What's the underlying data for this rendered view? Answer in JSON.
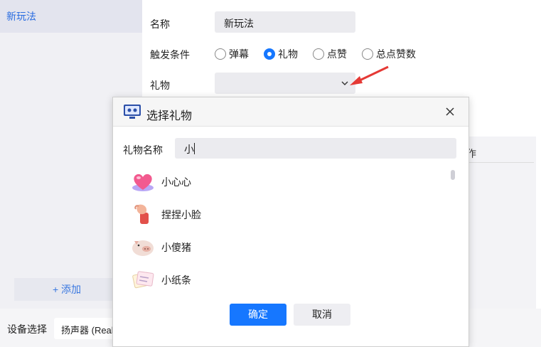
{
  "sidebar": {
    "items": [
      {
        "label": "新玩法"
      }
    ],
    "add_label": "+ 添加"
  },
  "form": {
    "name_label": "名称",
    "name_value": "新玩法",
    "trigger_label": "触发条件",
    "trigger_options": [
      {
        "label": "弹幕",
        "checked": false
      },
      {
        "label": "礼物",
        "checked": true
      },
      {
        "label": "点赞",
        "checked": false
      },
      {
        "label": "总点赞数",
        "checked": false
      }
    ],
    "gift_label": "礼物",
    "gift_value": ""
  },
  "table": {
    "ops_header": "作"
  },
  "bottom": {
    "device_label": "设备选择",
    "device_value": "扬声器 (Realt"
  },
  "dialog": {
    "title": "选择礼物",
    "search_label": "礼物名称",
    "search_value": "小",
    "gifts": [
      {
        "name": "小心心",
        "icon": "heart-gift-icon"
      },
      {
        "name": "捏捏小脸",
        "icon": "pinch-hand-gift-icon"
      },
      {
        "name": "小傻猪",
        "icon": "pig-gift-icon"
      },
      {
        "name": "小纸条",
        "icon": "note-gift-icon"
      }
    ],
    "confirm_label": "确定",
    "cancel_label": "取消"
  },
  "colors": {
    "accent": "#1677ff",
    "annotation_arrow": "#e53935",
    "sidebar_active_text": "#2b6de0"
  }
}
